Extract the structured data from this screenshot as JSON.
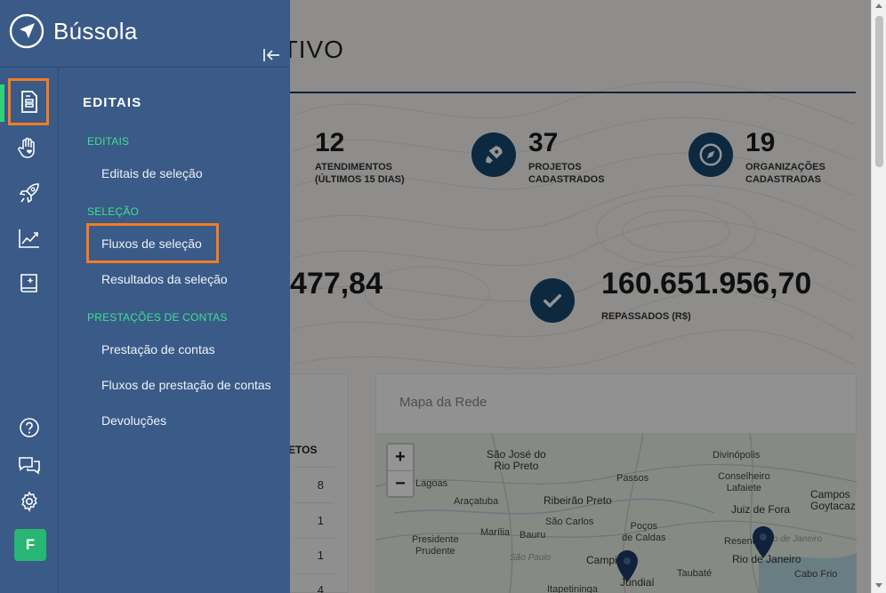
{
  "dashboard": {
    "title": "ATIVO",
    "stats": [
      {
        "value": "12",
        "label": "ATENDIMENTOS (ÚLTIMOS 15 DIAS)"
      },
      {
        "value": "37",
        "label": "PROJETOS CADASTRADOS"
      },
      {
        "value": "19",
        "label": "ORGANIZAÇÕES CADASTRADAS"
      }
    ],
    "big_left": {
      "value": "477,84"
    },
    "big_right": {
      "value": "160.651.956,70",
      "label": "REPASSADOS (R$)"
    },
    "table": {
      "header": "ETOS",
      "values": [
        "8",
        "1",
        "1",
        "4"
      ]
    },
    "map": {
      "title": "Mapa da Rede",
      "zoom_in": "+",
      "zoom_out": "−",
      "cities": {
        "sao_jose": "São José do\nRio Preto",
        "divinopolis": "Divinópolis",
        "lagoas": "Lagoas",
        "aracatuba": "Araçatuba",
        "ribeirao": "Ribeirão Preto",
        "passos": "Passos",
        "conselheiro": "Conselheiro\nLafaiete",
        "campos": "Campos\nGoytacaz",
        "sao_carlos": "São Carlos",
        "pocos": "Poços\nde Caldas",
        "presidente": "Presidente\nPrudente",
        "marilia": "Marília",
        "bauru": "Bauru",
        "juiz": "Juiz de Fora",
        "resende": "Resende",
        "rio_italic": "o de Janeiro",
        "rio": "Rio de Janeiro",
        "sao_paulo_italic": "São Paulo",
        "campinas": "Campi",
        "jundiai": "Jundiaí",
        "taubate": "Taubaté",
        "cabo_frio": "Cabo Frio",
        "itapetininga": "Itapetininga"
      }
    }
  },
  "sidebar": {
    "brand": "Bússola",
    "avatar_letter": "F",
    "rail_icons": [
      "document-icon",
      "heart-hand-icon",
      "rocket-icon",
      "chart-line-icon",
      "book-icon"
    ],
    "rail_bottom_icons": [
      "help-icon",
      "chat-icon",
      "gear-icon"
    ],
    "menu": {
      "title": "EDITAIS",
      "sections": [
        {
          "label": "EDITAIS",
          "links": [
            "Editais de seleção"
          ]
        },
        {
          "label": "SELEÇÃO",
          "links": [
            "Fluxos de seleção",
            "Resultados da seleção"
          ]
        },
        {
          "label": "PRESTAÇÕES DE CONTAS",
          "links": [
            "Prestação de contas",
            "Fluxos de prestação de contas",
            "Devoluções"
          ]
        }
      ]
    },
    "accent_color": "#31d27a",
    "highlight_color": "#f47d20"
  }
}
